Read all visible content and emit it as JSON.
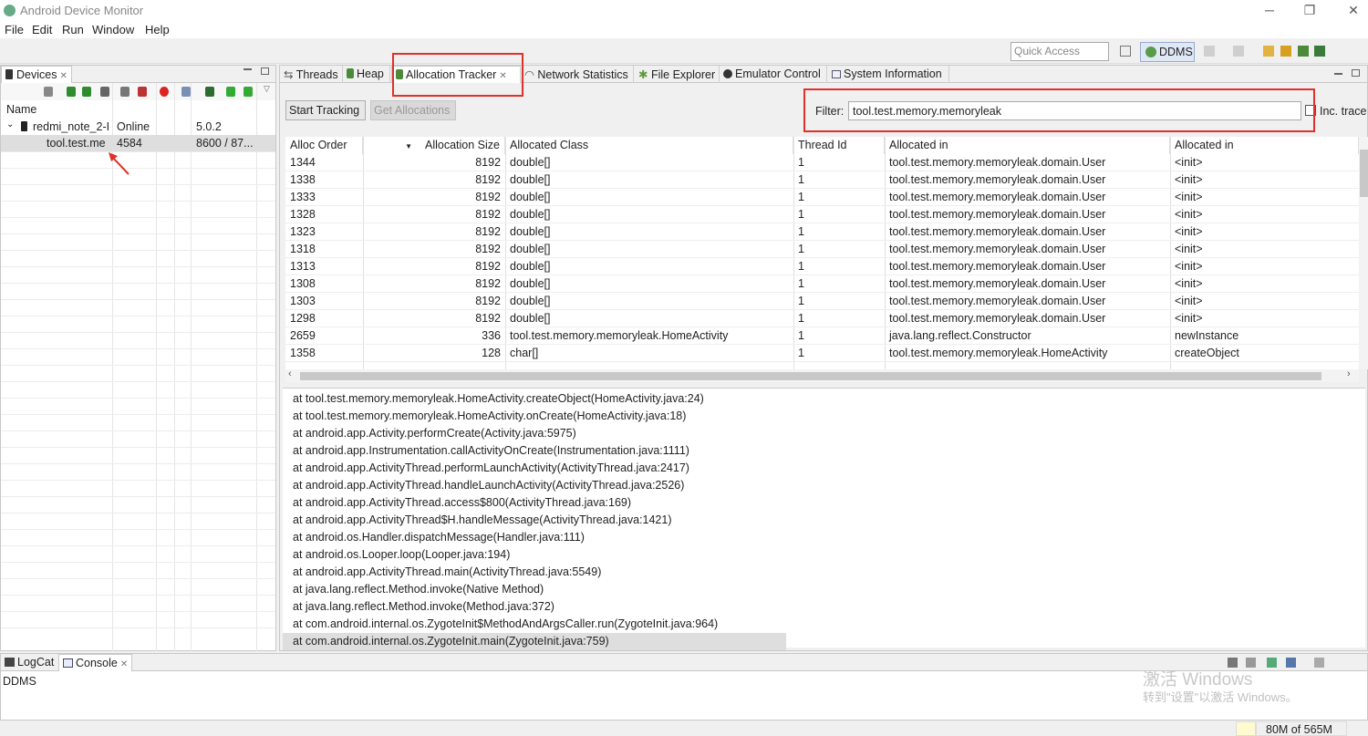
{
  "window": {
    "title": "Android Device Monitor",
    "controls": [
      "─",
      "❐",
      "✕"
    ]
  },
  "menu": [
    "File",
    "Edit",
    "Run",
    "Window",
    "Help"
  ],
  "toolbar": {
    "quick_access": "Quick Access",
    "perspective": "DDMS"
  },
  "devices_view": {
    "tab_label": "Devices",
    "col_name": "Name",
    "device": {
      "name": "redmi_note_2-I",
      "status": "Online",
      "version": "5.0.2"
    },
    "process": {
      "name": "tool.test.me",
      "pid": "4584",
      "port": "8600 / 87..."
    }
  },
  "main_tabs": [
    "Threads",
    "Heap",
    "Allocation Tracker",
    "Network Statistics",
    "File Explorer",
    "Emulator Control",
    "System Information"
  ],
  "alloc": {
    "start_label": "Start Tracking",
    "get_label": "Get Allocations",
    "filter_label": "Filter:",
    "filter_value": "tool.test.memory.memoryleak",
    "inc_trace": "Inc. trace",
    "headers": [
      "Alloc Order",
      "Allocation Size",
      "Allocated Class",
      "Thread Id",
      "Allocated in",
      "Allocated in"
    ],
    "rows": [
      [
        "1344",
        "8192",
        "double[]",
        "1",
        "tool.test.memory.memoryleak.domain.User",
        "<init>"
      ],
      [
        "1338",
        "8192",
        "double[]",
        "1",
        "tool.test.memory.memoryleak.domain.User",
        "<init>"
      ],
      [
        "1333",
        "8192",
        "double[]",
        "1",
        "tool.test.memory.memoryleak.domain.User",
        "<init>"
      ],
      [
        "1328",
        "8192",
        "double[]",
        "1",
        "tool.test.memory.memoryleak.domain.User",
        "<init>"
      ],
      [
        "1323",
        "8192",
        "double[]",
        "1",
        "tool.test.memory.memoryleak.domain.User",
        "<init>"
      ],
      [
        "1318",
        "8192",
        "double[]",
        "1",
        "tool.test.memory.memoryleak.domain.User",
        "<init>"
      ],
      [
        "1313",
        "8192",
        "double[]",
        "1",
        "tool.test.memory.memoryleak.domain.User",
        "<init>"
      ],
      [
        "1308",
        "8192",
        "double[]",
        "1",
        "tool.test.memory.memoryleak.domain.User",
        "<init>"
      ],
      [
        "1303",
        "8192",
        "double[]",
        "1",
        "tool.test.memory.memoryleak.domain.User",
        "<init>"
      ],
      [
        "1298",
        "8192",
        "double[]",
        "1",
        "tool.test.memory.memoryleak.domain.User",
        "<init>"
      ],
      [
        "2659",
        "336",
        "tool.test.memory.memoryleak.HomeActivity",
        "1",
        "java.lang.reflect.Constructor",
        "newInstance"
      ],
      [
        "1358",
        "128",
        "char[]",
        "1",
        "tool.test.memory.memoryleak.HomeActivity",
        "createObject"
      ]
    ],
    "trace": [
      "at tool.test.memory.memoryleak.HomeActivity.createObject(HomeActivity.java:24)",
      "at tool.test.memory.memoryleak.HomeActivity.onCreate(HomeActivity.java:18)",
      "at android.app.Activity.performCreate(Activity.java:5975)",
      "at android.app.Instrumentation.callActivityOnCreate(Instrumentation.java:1111)",
      "at android.app.ActivityThread.performLaunchActivity(ActivityThread.java:2417)",
      "at android.app.ActivityThread.handleLaunchActivity(ActivityThread.java:2526)",
      "at android.app.ActivityThread.access$800(ActivityThread.java:169)",
      "at android.app.ActivityThread$H.handleMessage(ActivityThread.java:1421)",
      "at android.os.Handler.dispatchMessage(Handler.java:111)",
      "at android.os.Looper.loop(Looper.java:194)",
      "at android.app.ActivityThread.main(ActivityThread.java:5549)",
      "at java.lang.reflect.Method.invoke(Native Method)",
      "at java.lang.reflect.Method.invoke(Method.java:372)",
      "at com.android.internal.os.ZygoteInit$MethodAndArgsCaller.run(ZygoteInit.java:964)",
      "at com.android.internal.os.ZygoteInit.main(ZygoteInit.java:759)"
    ]
  },
  "console": {
    "logcat_tab": "LogCat",
    "console_tab": "Console",
    "text": "DDMS"
  },
  "watermark": {
    "line1": "激活 Windows",
    "line2": "转到\"设置\"以激活 Windows。"
  },
  "status": {
    "memory": "80M of 565M"
  },
  "colors": {
    "annotation_red": "#e0302a",
    "selection": "#dedede"
  }
}
